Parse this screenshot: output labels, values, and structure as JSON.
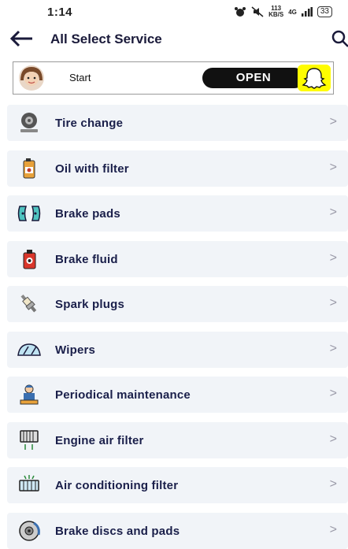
{
  "status": {
    "time": "1:14",
    "speed": "113",
    "speed_unit": "KB/S",
    "network": "4G",
    "battery": "33"
  },
  "header": {
    "title": "All Select Service"
  },
  "ad": {
    "text": "Start",
    "button": "OPEN"
  },
  "services": [
    {
      "label": "Tire change",
      "chevron": ">",
      "icon": "tire-icon"
    },
    {
      "label": "Oil with filter",
      "chevron": ">",
      "icon": "oil-can-icon"
    },
    {
      "label": "Brake pads",
      "chevron": ">",
      "icon": "brake-pads-icon"
    },
    {
      "label": "Brake fluid",
      "chevron": ">",
      "icon": "brake-fluid-icon"
    },
    {
      "label": "Spark plugs",
      "chevron": ">",
      "icon": "spark-plug-icon"
    },
    {
      "label": "Wipers",
      "chevron": ">",
      "icon": "wiper-icon"
    },
    {
      "label": "Periodical maintenance",
      "chevron": ">",
      "icon": "mechanic-icon"
    },
    {
      "label": "Engine air filter",
      "chevron": ">",
      "icon": "air-filter-icon"
    },
    {
      "label": "Air conditioning filter",
      "chevron": ">",
      "icon": "ac-filter-icon"
    },
    {
      "label": "Brake discs and pads",
      "chevron": ">",
      "icon": "brake-disc-icon"
    }
  ],
  "colors": {
    "item_bg": "#f1f4f8",
    "label": "#1a1f4a",
    "snap_yellow": "#fffc00"
  }
}
